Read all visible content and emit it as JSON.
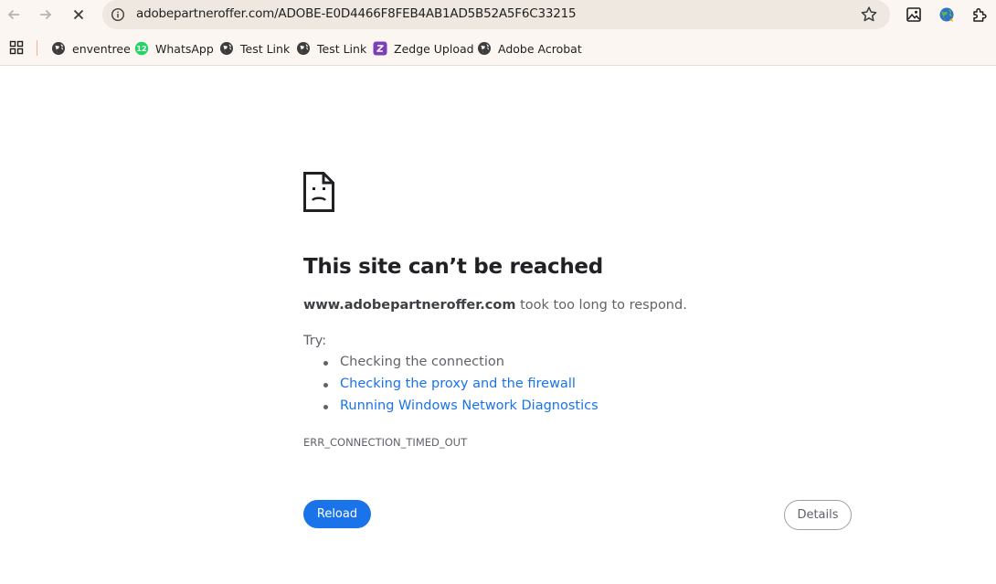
{
  "toolbar": {
    "url": "adobepartneroffer.com/ADOBE-E0D4466F8FEB4AB1AD5B52A5F6C33215"
  },
  "bookmarks": [
    {
      "label": "enventree",
      "icon": "globe-icon"
    },
    {
      "label": "WhatsApp",
      "icon": "whatsapp-icon",
      "badge": "12"
    },
    {
      "label": "Test Link",
      "icon": "globe-icon"
    },
    {
      "label": "Test Link",
      "icon": "globe-icon"
    },
    {
      "label": "Zedge Upload",
      "icon": "zedge-icon"
    },
    {
      "label": "Adobe Acrobat",
      "icon": "globe-icon"
    }
  ],
  "error": {
    "title": "This site can’t be reached",
    "host": "www.adobepartneroffer.com",
    "message": " took too long to respond.",
    "try_label": "Try:",
    "suggestions": [
      "Checking the connection",
      "Checking the proxy and the firewall",
      "Running Windows Network Diagnostics"
    ],
    "code": "ERR_CONNECTION_TIMED_OUT",
    "reload_label": "Reload",
    "details_label": "Details"
  },
  "colors": {
    "accent": "#1a73e8",
    "toolbar_bg": "#fbf6f1",
    "omnibox_bg": "#efe8e1",
    "whatsapp": "#25d366",
    "zedge": "#7b3fb8"
  }
}
